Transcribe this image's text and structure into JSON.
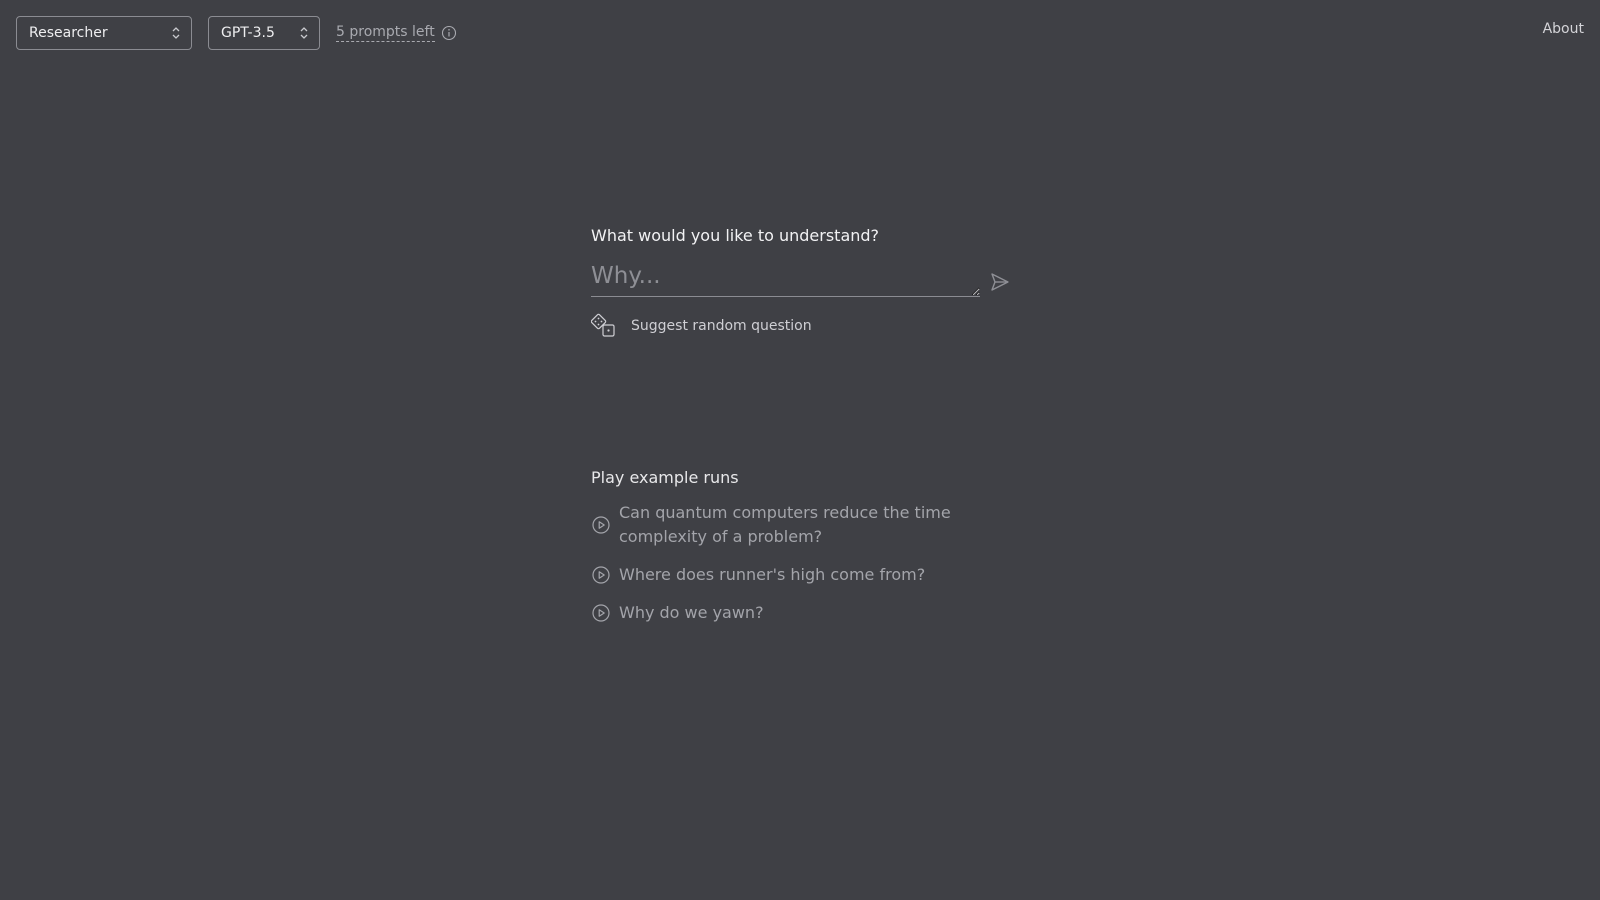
{
  "topbar": {
    "role_select": {
      "value": "Researcher"
    },
    "model_select": {
      "value": "GPT-3.5"
    },
    "prompts_left": "5 prompts left",
    "about": "About"
  },
  "main": {
    "title": "What would you like to understand?",
    "input_placeholder": "Why...",
    "suggest_label": "Suggest random question"
  },
  "examples": {
    "title": "Play example runs",
    "items": [
      "Can quantum computers reduce the time complexity of a problem?",
      "Where does runner's high come from?",
      "Why do we yawn?"
    ]
  },
  "colors": {
    "background": "#3f4045",
    "text": "#e6e6e8",
    "muted": "#a3a4aa",
    "border": "#8b8c92"
  },
  "icons": {
    "select_chevron": "chevron-up-down-icon",
    "info": "info-icon",
    "send": "send-icon",
    "dice": "dice-icon",
    "play": "play-circle-icon"
  }
}
